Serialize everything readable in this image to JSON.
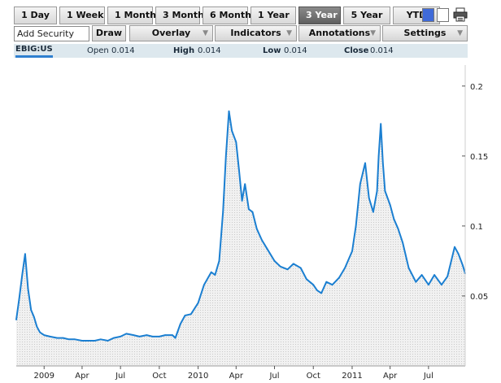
{
  "toolbar": {
    "ranges": [
      {
        "label": "1 Day",
        "active": false
      },
      {
        "label": "1 Week",
        "active": false
      },
      {
        "label": "1 Month",
        "active": false
      },
      {
        "label": "3 Month",
        "active": false
      },
      {
        "label": "6 Month",
        "active": false
      },
      {
        "label": "1 Year",
        "active": false
      },
      {
        "label": "3 Year",
        "active": true
      },
      {
        "label": "5 Year",
        "active": false
      },
      {
        "label": "YTD",
        "active": false
      }
    ],
    "add_security_value": "Add Security",
    "draw_label": "Draw",
    "overlay_label": "Overlay",
    "indicators_label": "Indicators",
    "annotations_label": "Annotations",
    "settings_label": "Settings",
    "icons": [
      "color-swatch-blue-icon",
      "color-swatch-white-icon",
      "printer-icon"
    ]
  },
  "quote": {
    "symbol": "EBIG:US",
    "open_label": "Open",
    "open_value": "0.014",
    "high_label": "High",
    "high_value": "0.014",
    "low_label": "Low",
    "low_value": "0.014",
    "close_label": "Close",
    "close_value": "0.014"
  },
  "colors": {
    "line": "#1b7fd1",
    "fill": "#e6e6e6",
    "active_button": "#6e6e6e",
    "info_bar": "#dde8ee"
  },
  "chart_data": {
    "type": "area",
    "title": "",
    "xlabel": "",
    "ylabel": "",
    "x_range": [
      "2008-10-27",
      "2011-09-26"
    ],
    "ylim": [
      0,
      0.215
    ],
    "y_ticks": [
      0.05,
      0.1,
      0.15,
      0.2
    ],
    "y_tick_labels": [
      "0.05",
      "0.1",
      "0.15",
      "0.2"
    ],
    "x_ticks": [
      "2009-01-01",
      "2009-04-01",
      "2009-07-01",
      "2009-10-01",
      "2010-01-01",
      "2010-04-01",
      "2010-07-01",
      "2010-10-01",
      "2011-01-01",
      "2011-04-01",
      "2011-07-01"
    ],
    "x_tick_labels": [
      "2009",
      "Apr",
      "Jul",
      "Oct",
      "2010",
      "Apr",
      "Jul",
      "Oct",
      "2011",
      "Apr",
      "Jul"
    ],
    "grid": false,
    "y_axis_side": "right",
    "series": [
      {
        "x": [
          "2008-10-27",
          "2008-11-03",
          "2008-11-10",
          "2008-11-17",
          "2008-11-24",
          "2008-12-01",
          "2008-12-08",
          "2008-12-15",
          "2008-12-22",
          "2009-01-01",
          "2009-01-15",
          "2009-02-01",
          "2009-02-15",
          "2009-03-01",
          "2009-03-15",
          "2009-04-01",
          "2009-04-15",
          "2009-05-01",
          "2009-05-15",
          "2009-06-01",
          "2009-06-08",
          "2009-06-15",
          "2009-07-01",
          "2009-07-15",
          "2009-08-01",
          "2009-08-15",
          "2009-09-01",
          "2009-09-15",
          "2009-10-01",
          "2009-10-15",
          "2009-11-01",
          "2009-11-08",
          "2009-11-20",
          "2009-12-01",
          "2009-12-15",
          "2010-01-01",
          "2010-01-15",
          "2010-02-01",
          "2010-02-10",
          "2010-02-20",
          "2010-03-01",
          "2010-03-08",
          "2010-03-15",
          "2010-03-22",
          "2010-04-01",
          "2010-04-08",
          "2010-04-15",
          "2010-04-22",
          "2010-05-01",
          "2010-05-10",
          "2010-05-20",
          "2010-06-01",
          "2010-06-15",
          "2010-07-01",
          "2010-07-15",
          "2010-08-01",
          "2010-08-15",
          "2010-09-01",
          "2010-09-15",
          "2010-10-01",
          "2010-10-10",
          "2010-10-20",
          "2010-11-01",
          "2010-11-15",
          "2010-12-01",
          "2010-12-15",
          "2011-01-01",
          "2011-01-10",
          "2011-01-20",
          "2011-02-01",
          "2011-02-10",
          "2011-02-20",
          "2011-03-01",
          "2011-03-05",
          "2011-03-10",
          "2011-03-15",
          "2011-03-20",
          "2011-04-01",
          "2011-04-10",
          "2011-04-20",
          "2011-05-01",
          "2011-05-15",
          "2011-06-01",
          "2011-06-15",
          "2011-07-01",
          "2011-07-15",
          "2011-08-01",
          "2011-08-15",
          "2011-09-01",
          "2011-09-10",
          "2011-09-20",
          "2011-09-26"
        ],
        "values": [
          0.033,
          0.048,
          0.065,
          0.08,
          0.055,
          0.04,
          0.035,
          0.028,
          0.024,
          0.022,
          0.021,
          0.02,
          0.02,
          0.019,
          0.019,
          0.018,
          0.018,
          0.018,
          0.019,
          0.018,
          0.019,
          0.02,
          0.021,
          0.023,
          0.022,
          0.021,
          0.022,
          0.021,
          0.021,
          0.022,
          0.022,
          0.02,
          0.03,
          0.036,
          0.037,
          0.045,
          0.058,
          0.067,
          0.065,
          0.075,
          0.11,
          0.15,
          0.182,
          0.168,
          0.16,
          0.14,
          0.118,
          0.13,
          0.112,
          0.11,
          0.098,
          0.09,
          0.083,
          0.075,
          0.071,
          0.069,
          0.073,
          0.07,
          0.062,
          0.058,
          0.054,
          0.052,
          0.06,
          0.058,
          0.063,
          0.07,
          0.082,
          0.1,
          0.13,
          0.145,
          0.12,
          0.11,
          0.125,
          0.15,
          0.173,
          0.145,
          0.125,
          0.115,
          0.105,
          0.098,
          0.088,
          0.07,
          0.06,
          0.065,
          0.058,
          0.065,
          0.058,
          0.064,
          0.085,
          0.08,
          0.072,
          0.066
        ]
      }
    ]
  }
}
